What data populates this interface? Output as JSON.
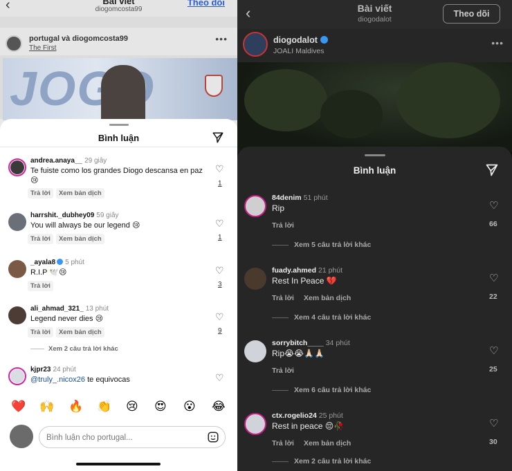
{
  "left": {
    "top": {
      "title": "Bài viết",
      "subtitle": "diogomcosta99",
      "follow": "Theo dõi",
      "post_names": "portugal và diogomcosta99",
      "post_song": "The First",
      "big_text": "JOGO"
    },
    "sheet_title": "Bình luận",
    "comments": [
      {
        "user": "andrea.anaya__",
        "time": "29 giây",
        "text": "Te fuiste como los grandes Diogo descansa en paz 😢",
        "reply": "Trả lời",
        "translate": "Xem bản dịch",
        "likes": "1"
      },
      {
        "user": "harrshit._dubhey09",
        "time": "59 giây",
        "text": "You will always be our legend 😢",
        "reply": "Trả lời",
        "translate": "Xem bản dịch",
        "likes": "1"
      },
      {
        "user": "_ayala8",
        "time": "5 phút",
        "text": "R.I.P 🕊️😢",
        "reply": "Trả lời",
        "likes": "3"
      },
      {
        "user": "ali_ahmad_321_",
        "time": "13 phút",
        "text": "Legend never dies 😢",
        "reply": "Trả lời",
        "translate": "Xem bản dịch",
        "likes": "9",
        "more_replies": "Xem 2 câu trả lời khác"
      },
      {
        "user": "kjpr23",
        "time": "24 phút",
        "mention": "@truly_.nicox26",
        "text": " te equivocas"
      }
    ],
    "emojis": [
      "❤️",
      "🙌",
      "🔥",
      "👏",
      "😢",
      "😍",
      "😮",
      "😂"
    ],
    "input_placeholder": "Bình luận cho portugal..."
  },
  "right": {
    "header_title": "Bài viết",
    "header_sub": "diogodalot",
    "follow": "Theo dõi",
    "post_user": "diogodalot",
    "post_location": "JOALI Maldives",
    "sheet_title": "Bình luận",
    "comments": [
      {
        "user": "84denim",
        "time": "51 phút",
        "text": "Rip",
        "reply": "Trả lời",
        "likes": "66",
        "more_replies": "Xem 5 câu trả lời khác"
      },
      {
        "user": "fuady.ahmed",
        "time": "21 phút",
        "text": "Rest In Peace 💔",
        "reply": "Trả lời",
        "translate": "Xem bản dịch",
        "likes": "22",
        "more_replies": "Xem 4 câu trả lời khác"
      },
      {
        "user": "sorrybitch____",
        "time": "34 phút",
        "text": "Rip😭😭🙏🏻🙏🏻",
        "reply": "Trả lời",
        "likes": "25",
        "more_replies": "Xem 6 câu trả lời khác"
      },
      {
        "user": "ctx.rogelio24",
        "time": "25 phút",
        "text": "Rest in peace 😔🥀",
        "reply": "Trả lời",
        "translate": "Xem bản dịch",
        "likes": "30",
        "more_replies": "Xem 2 câu trả lời khác"
      }
    ]
  }
}
